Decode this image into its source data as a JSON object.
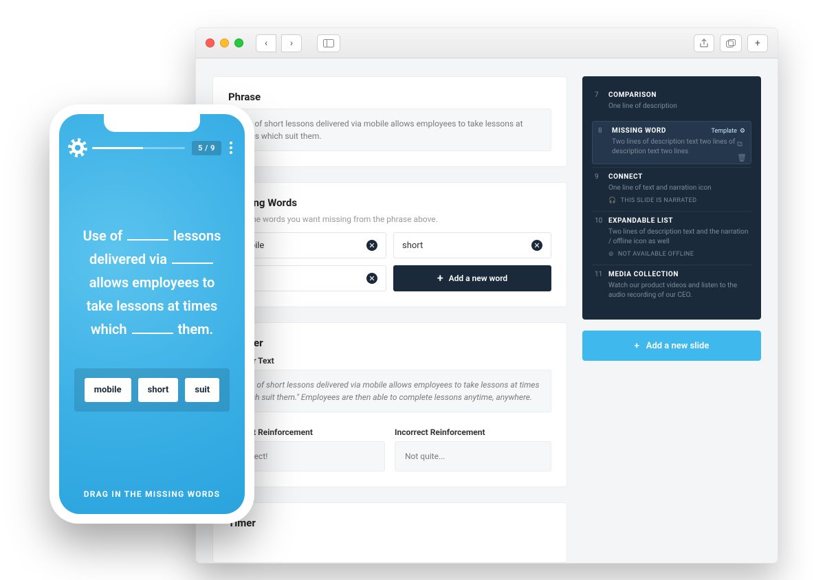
{
  "browser": {
    "cards": {
      "phrase": {
        "title": "Phrase",
        "text": "Use of short lessons delivered via mobile allows employees to take lessons at times which suit them."
      },
      "missing": {
        "title": "Missing Words",
        "subtitle": "Input the words you want missing from the phrase above.",
        "words": [
          "mobile",
          "short",
          "suit"
        ],
        "add_label": "Add a new word"
      },
      "answer": {
        "title": "Answer",
        "answer_text_label": "Answer Text",
        "answer_text": "\"Use of short lessons delivered via mobile allows employees to take lessons at times which suit them.\" Employees are then able to complete lessons anytime, anywhere.",
        "correct_label": "Correct Reinforcement",
        "correct_value": "Correct!",
        "incorrect_label": "Incorrect Reinforcement",
        "incorrect_value": "Not quite..."
      },
      "timer": {
        "title": "Timer"
      }
    },
    "sidebar": {
      "slides": [
        {
          "num": "7",
          "name": "COMPARISON",
          "desc": "One line of description"
        },
        {
          "num": "8",
          "name": "MISSING WORD",
          "desc": "Two lines of description text two lines of description text two lines",
          "selected": true,
          "badge": "Template"
        },
        {
          "num": "9",
          "name": "CONNECT",
          "desc": "One line of text and narration icon",
          "meta": "THIS SLIDE IS NARRATED"
        },
        {
          "num": "10",
          "name": "EXPANDABLE LIST",
          "desc": "Two lines of description text and the narration / offline icon as well",
          "meta": "NOT AVAILABLE OFFLINE"
        },
        {
          "num": "11",
          "name": "MEDIA COLLECTION",
          "desc": "Watch our product videos and listen to the audio recording of our CEO."
        }
      ],
      "add_slide_label": "Add a new slide"
    }
  },
  "phone": {
    "counter": "5 / 9",
    "phrase_parts": [
      "Use of ",
      " lessons delivered via ",
      " allows employees to take lessons at times which ",
      " them."
    ],
    "choices": [
      "mobile",
      "short",
      "suit"
    ],
    "instruction": "DRAG IN THE MISSING WORDS"
  }
}
